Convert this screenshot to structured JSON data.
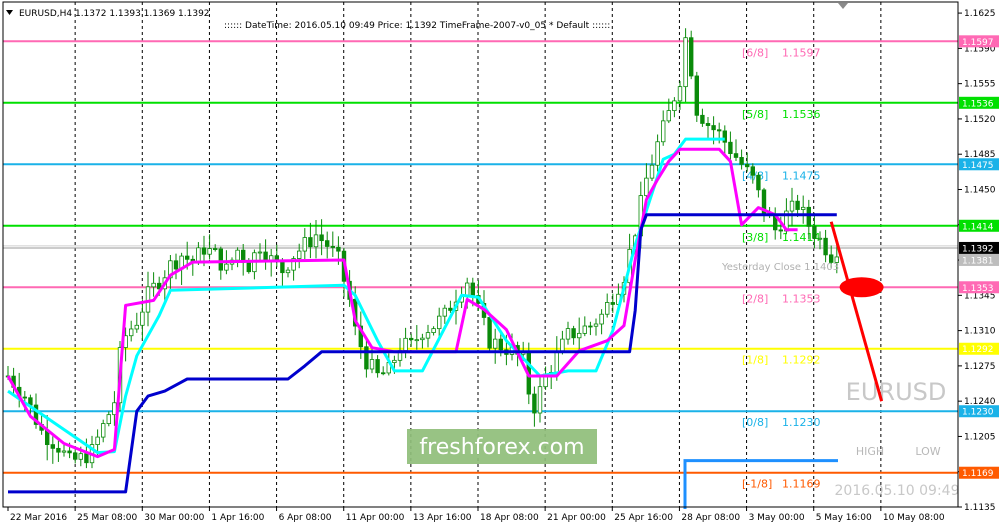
{
  "header": {
    "symbol_line": "EURUSD,H4  1.1372 1.1393 1.1369 1.1392",
    "info_line": ":::::: DateTime: 2016.05.10 09:49    Price: 1.1392    TimeFrame-2007-v0_05    *    Default  ::::::"
  },
  "watermark": {
    "symbol": "EURUSD",
    "brand": "freshforex.com",
    "timestamp": "2016.05.10 09:49",
    "high_label": "HIGH",
    "low_label": "LOW"
  },
  "yesterday_close_label": "Yesterday Close 1.1403",
  "colors": {
    "pink": "#ff69b4",
    "lime": "#00e000",
    "cyan": "#1ab2e8",
    "yellow": "#ffff00",
    "orange": "#ff5a00",
    "candle": "#0a8a0a",
    "bull_fill": "#ffffff",
    "magenta": "#ff00ff",
    "aqua": "#00ffff",
    "blue": "#0000cd",
    "arrow": "#ff0000"
  },
  "chart_data": {
    "type": "candlestick",
    "symbol": "EURUSD",
    "timeframe": "H4",
    "ylim": [
      1.1135,
      1.1636
    ],
    "price_ticks": [
      "1.1625",
      "1.1590",
      "1.1555",
      "1.1520",
      "1.1485",
      "1.1450",
      "1.1415",
      "1.1380",
      "1.1345",
      "1.1310",
      "1.1275",
      "1.1240",
      "1.1205",
      "1.1170",
      "1.1135"
    ],
    "time_labels": [
      "22 Mar 2016",
      "25 Mar 08:00",
      "30 Mar 00:00",
      "1 Apr 16:00",
      "6 Apr 08:00",
      "11 Apr 00:00",
      "13 Apr 16:00",
      "18 Apr 08:00",
      "21 Apr 00:00",
      "25 Apr 16:00",
      "28 Apr 08:00",
      "3 May 00:00",
      "5 May 16:00",
      "10 May 08:00"
    ],
    "murrey_levels": [
      {
        "label": "[6/8]",
        "value": 1.1597,
        "color": "pink"
      },
      {
        "label": "[5/8]",
        "value": 1.1536,
        "color": "lime"
      },
      {
        "label": "[4/8]",
        "value": 1.1475,
        "color": "cyan"
      },
      {
        "label": "[3/8]",
        "value": 1.1414,
        "color": "lime"
      },
      {
        "label": "[2/8]",
        "value": 1.1353,
        "color": "pink"
      },
      {
        "label": "[1/8]",
        "value": 1.1292,
        "color": "yellow"
      },
      {
        "label": "[0/8]",
        "value": 1.123,
        "color": "cyan"
      },
      {
        "label": "[-1/8]",
        "value": 1.1169,
        "color": "orange"
      }
    ],
    "current_price": 1.1392,
    "yesterday_close": 1.1403,
    "blue_level": 1.1181,
    "key_points": [
      [
        0,
        1.1265
      ],
      [
        3,
        1.1245
      ],
      [
        6,
        1.121
      ],
      [
        9,
        1.1195
      ],
      [
        11,
        1.118
      ],
      [
        13,
        1.1183
      ],
      [
        15,
        1.119
      ],
      [
        17,
        1.1215
      ],
      [
        19,
        1.124
      ],
      [
        20,
        1.1285
      ],
      [
        21,
        1.1305
      ],
      [
        23,
        1.132
      ],
      [
        25,
        1.1345
      ],
      [
        27,
        1.136
      ],
      [
        29,
        1.1375
      ],
      [
        31,
        1.1385
      ],
      [
        33,
        1.1378
      ],
      [
        35,
        1.1392
      ],
      [
        37,
        1.1385
      ],
      [
        39,
        1.137
      ],
      [
        41,
        1.139
      ],
      [
        43,
        1.1375
      ],
      [
        45,
        1.1395
      ],
      [
        47,
        1.138
      ],
      [
        49,
        1.137
      ],
      [
        51,
        1.1385
      ],
      [
        53,
        1.1395
      ],
      [
        55,
        1.1405
      ],
      [
        57,
        1.1395
      ],
      [
        59,
        1.138
      ],
      [
        61,
        1.134
      ],
      [
        62,
        1.131
      ],
      [
        64,
        1.128
      ],
      [
        66,
        1.1265
      ],
      [
        68,
        1.127
      ],
      [
        70,
        1.1295
      ],
      [
        72,
        1.1295
      ],
      [
        74,
        1.131
      ],
      [
        76,
        1.1315
      ],
      [
        78,
        1.1325
      ],
      [
        80,
        1.1345
      ],
      [
        82,
        1.136
      ],
      [
        84,
        1.133
      ],
      [
        86,
        1.13
      ],
      [
        88,
        1.1295
      ],
      [
        90,
        1.129
      ],
      [
        92,
        1.128
      ],
      [
        93,
        1.125
      ],
      [
        94,
        1.1235
      ],
      [
        96,
        1.1265
      ],
      [
        98,
        1.1285
      ],
      [
        100,
        1.1305
      ],
      [
        102,
        1.131
      ],
      [
        104,
        1.1315
      ],
      [
        106,
        1.1325
      ],
      [
        108,
        1.1345
      ],
      [
        110,
        1.1365
      ],
      [
        112,
        1.141
      ],
      [
        114,
        1.146
      ],
      [
        116,
        1.1495
      ],
      [
        118,
        1.1525
      ],
      [
        120,
        1.156
      ],
      [
        121,
        1.16
      ],
      [
        122,
        1.157
      ],
      [
        123,
        1.153
      ],
      [
        125,
        1.1515
      ],
      [
        127,
        1.1505
      ],
      [
        129,
        1.149
      ],
      [
        131,
        1.1475
      ],
      [
        133,
        1.146
      ],
      [
        135,
        1.143
      ],
      [
        137,
        1.141
      ],
      [
        139,
        1.1425
      ],
      [
        141,
        1.1435
      ],
      [
        143,
        1.1415
      ],
      [
        145,
        1.14
      ],
      [
        147,
        1.1385
      ],
      [
        148,
        1.1392
      ]
    ],
    "magenta_line": [
      [
        0,
        1.1265
      ],
      [
        4,
        1.1225
      ],
      [
        10,
        1.1198
      ],
      [
        16,
        1.1185
      ],
      [
        19,
        1.1192
      ],
      [
        21,
        1.1335
      ],
      [
        26,
        1.134
      ],
      [
        29,
        1.1365
      ],
      [
        33,
        1.1378
      ],
      [
        60,
        1.138
      ],
      [
        62,
        1.132
      ],
      [
        65,
        1.1293
      ],
      [
        69,
        1.1289
      ],
      [
        80,
        1.1289
      ],
      [
        82,
        1.1341
      ],
      [
        85,
        1.1331
      ],
      [
        89,
        1.1311
      ],
      [
        93,
        1.1265
      ],
      [
        98,
        1.1265
      ],
      [
        102,
        1.129
      ],
      [
        107,
        1.13
      ],
      [
        110,
        1.1315
      ],
      [
        112,
        1.138
      ],
      [
        114,
        1.144
      ],
      [
        116,
        1.146
      ],
      [
        118,
        1.1478
      ],
      [
        120,
        1.149
      ],
      [
        127,
        1.149
      ],
      [
        129,
        1.1478
      ],
      [
        131,
        1.1415
      ],
      [
        134,
        1.1432
      ],
      [
        137,
        1.1425
      ],
      [
        139,
        1.141
      ],
      [
        141,
        1.141
      ]
    ],
    "aqua_line": [
      [
        0,
        1.125
      ],
      [
        16,
        1.1189
      ],
      [
        19,
        1.119
      ],
      [
        21,
        1.1245
      ],
      [
        23,
        1.1285
      ],
      [
        27,
        1.1325
      ],
      [
        29,
        1.135
      ],
      [
        60,
        1.1355
      ],
      [
        62,
        1.1345
      ],
      [
        66,
        1.13
      ],
      [
        69,
        1.127
      ],
      [
        74,
        1.127
      ],
      [
        81,
        1.1345
      ],
      [
        84,
        1.1343
      ],
      [
        89,
        1.13
      ],
      [
        95,
        1.1265
      ],
      [
        100,
        1.127
      ],
      [
        105,
        1.127
      ],
      [
        108,
        1.131
      ],
      [
        112,
        1.1395
      ],
      [
        117,
        1.148
      ],
      [
        119,
        1.1485
      ],
      [
        121,
        1.15
      ],
      [
        128,
        1.15
      ]
    ],
    "blue_line": [
      [
        0,
        1.115
      ],
      [
        21,
        1.115
      ],
      [
        23,
        1.123
      ],
      [
        25,
        1.1245
      ],
      [
        28,
        1.125
      ],
      [
        32,
        1.1262
      ],
      [
        50,
        1.1262
      ],
      [
        53,
        1.1275
      ],
      [
        56,
        1.1289
      ],
      [
        80,
        1.1289
      ],
      [
        111,
        1.1289
      ],
      [
        112,
        1.133
      ],
      [
        113,
        1.141
      ],
      [
        114,
        1.1425
      ],
      [
        148,
        1.1425
      ]
    ],
    "arrow": {
      "from": [
        147,
        1.1418
      ],
      "to": [
        156,
        1.124
      ]
    },
    "ellipse_center": [
      151,
      1.1353
    ]
  }
}
